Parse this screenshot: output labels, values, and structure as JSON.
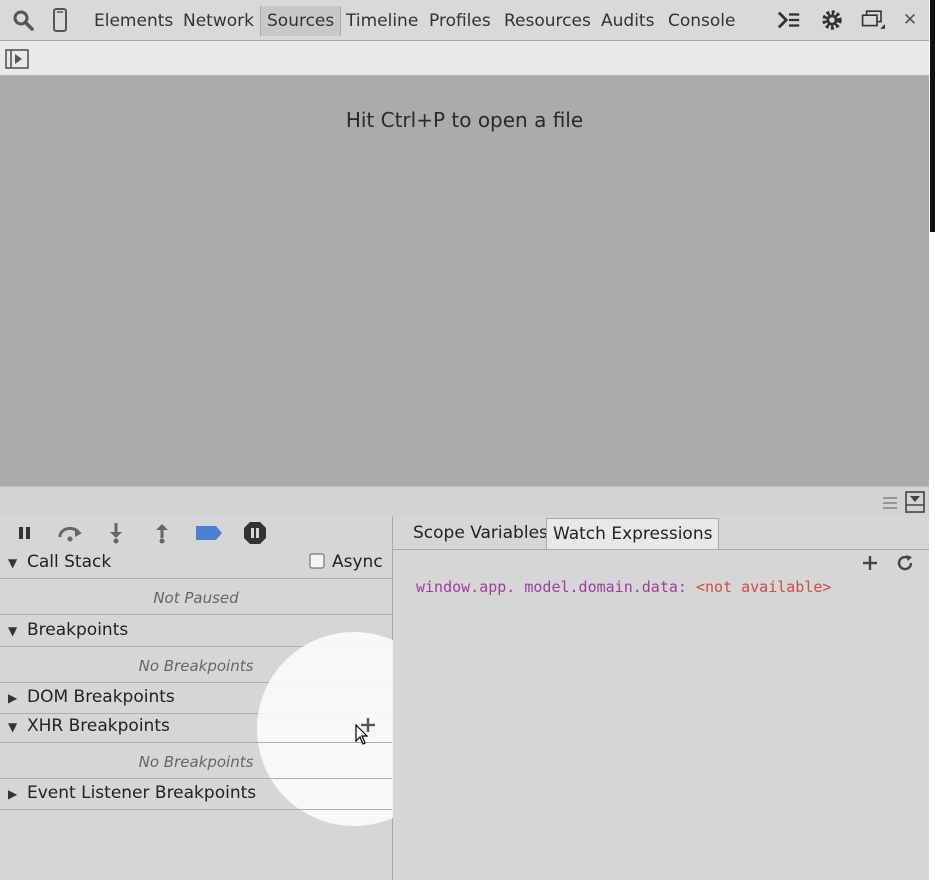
{
  "topbar": {
    "tabs": [
      {
        "label": "Elements"
      },
      {
        "label": "Network"
      },
      {
        "label": "Sources"
      },
      {
        "label": "Timeline"
      },
      {
        "label": "Profiles"
      },
      {
        "label": "Resources"
      },
      {
        "label": "Audits"
      },
      {
        "label": "Console"
      }
    ],
    "active_tab": "Sources",
    "close_glyph": "✕"
  },
  "editor": {
    "hint": "Hit Ctrl+P to open a file"
  },
  "sidebar": {
    "call_stack": {
      "title": "Call Stack",
      "async_label": "Async",
      "async_checked": false,
      "body": "Not Paused"
    },
    "breakpoints": {
      "title": "Breakpoints",
      "body": "No Breakpoints"
    },
    "dom_breakpoints": {
      "title": "DOM Breakpoints"
    },
    "xhr_breakpoints": {
      "title": "XHR Breakpoints",
      "body": "No Breakpoints"
    },
    "event_listener_breakpoints": {
      "title": "Event Listener Breakpoints"
    }
  },
  "right": {
    "tabs": [
      {
        "label": "Scope Variables"
      },
      {
        "label": "Watch Expressions"
      }
    ],
    "active_tab": "Watch Expressions",
    "watch": [
      {
        "expression": "window.app. model.domain.data",
        "separator": ":",
        "value": "<not available>"
      }
    ]
  },
  "colors": {
    "accent_blue": "#4a7fd1",
    "watch_name": "#9b3f9b",
    "watch_value": "#d64a3d"
  }
}
